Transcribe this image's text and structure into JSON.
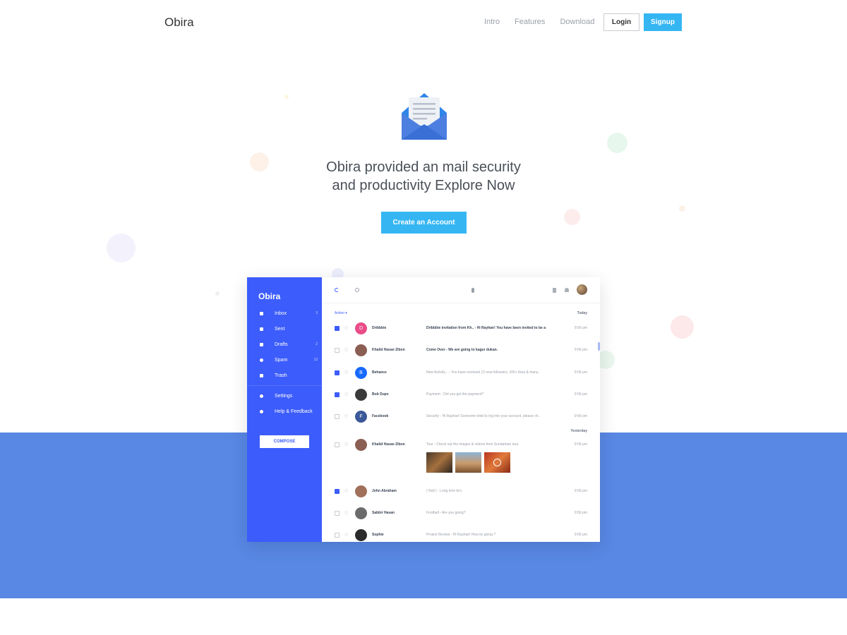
{
  "header": {
    "logo": "Obira",
    "nav": [
      "Intro",
      "Features",
      "Download"
    ],
    "login_label": "Login",
    "signup_label": "Signup"
  },
  "hero": {
    "title_line1": "Obira provided an mail security",
    "title_line2": "and productivity Explore Now",
    "cta_label": "Create an Account",
    "icon": "envelope-open-icon"
  },
  "colors": {
    "accent": "#35b6f3",
    "sidebar": "#3c5cfb",
    "band": "#5887e4"
  },
  "app": {
    "logo": "Obira",
    "folders": [
      {
        "label": "Inbox",
        "count": "3",
        "icon": "inbox-icon"
      },
      {
        "label": "Sent",
        "count": "",
        "icon": "send-icon"
      },
      {
        "label": "Drafts",
        "count": "2",
        "icon": "draft-icon"
      },
      {
        "label": "Spam",
        "count": "13",
        "icon": "spam-icon"
      },
      {
        "label": "Trash",
        "count": "",
        "icon": "trash-icon"
      }
    ],
    "extras": [
      {
        "label": "Settings",
        "icon": "gear-icon"
      },
      {
        "label": "Help & Feedback",
        "icon": "help-icon"
      }
    ],
    "compose_label": "COMPOSE",
    "action_label": "Action",
    "today_label": "Today",
    "yesterday_label": "Yesterday",
    "emails": [
      {
        "sender": "Dribbble",
        "initial": "D",
        "avatar_color": "#ea4c89",
        "subject": "Dribbble invitation from Kh.. - Hi Rayhan! You have been invited to be a",
        "time": "9:56 pm",
        "checked": true,
        "unread": true
      },
      {
        "sender": "Khalid Hasan Zibon",
        "initial": "",
        "avatar_color": "#8b5e54",
        "subject": "Come Over - We are going to kagur dukan.",
        "time": "9:56 pm",
        "checked": false,
        "unread": true
      },
      {
        "sender": "Behance",
        "initial": "B",
        "avatar_color": "#1769ff",
        "subject": "New Activity... - You have received 12 new followers, 100+ likes & many..",
        "time": "9:56 pm",
        "checked": true,
        "unread": false
      },
      {
        "sender": "Bob Dupx",
        "initial": "",
        "avatar_color": "#3a3a3a",
        "subject": "Payment - Did you get the payment?",
        "time": "9:56 pm",
        "checked": true,
        "unread": false
      },
      {
        "sender": "Facebook",
        "initial": "F",
        "avatar_color": "#3b5998",
        "subject": "Security - Hi Rayhan! Someone tried to log into your account. please ch..",
        "time": "9:56 pm",
        "checked": false,
        "unread": false
      },
      {
        "sender": "Khalid Hasan Zibon",
        "initial": "",
        "avatar_color": "#8b5e54",
        "subject": "Tour - Check out the images & videos from Sundarban tour.",
        "time": "9:56 pm",
        "checked": false,
        "unread": false
      },
      {
        "sender": "John Abraham",
        "initial": "",
        "avatar_color": "#a0705a",
        "subject": "( Null ) - Long time bro.",
        "time": "9:56 pm",
        "checked": true,
        "unread": false
      },
      {
        "sender": "Sabbir Hasan",
        "initial": "",
        "avatar_color": "#6b6b6b",
        "subject": "Football - Are you going?",
        "time": "9:56 pm",
        "checked": false,
        "unread": false
      },
      {
        "sender": "Sophie",
        "initial": "",
        "avatar_color": "#2b2b2b",
        "subject": "Project Review - Hi Rayhan! How its going ?",
        "time": "9:56 pm",
        "checked": false,
        "unread": false
      }
    ]
  }
}
